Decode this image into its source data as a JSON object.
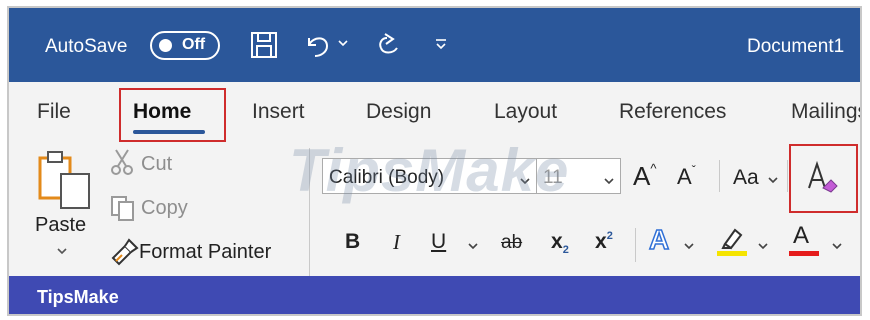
{
  "titlebar": {
    "autosave_label": "AutoSave",
    "autosave_state": "Off",
    "document_title": "Document1"
  },
  "tabs": [
    {
      "label": "File",
      "active": false
    },
    {
      "label": "Home",
      "active": true
    },
    {
      "label": "Insert",
      "active": false
    },
    {
      "label": "Design",
      "active": false
    },
    {
      "label": "Layout",
      "active": false
    },
    {
      "label": "References",
      "active": false
    },
    {
      "label": "Mailings",
      "active": false
    }
  ],
  "clipboard": {
    "paste_label": "Paste",
    "cut_label": "Cut",
    "copy_label": "Copy",
    "format_painter_label": "Format Painter"
  },
  "font": {
    "name": "Calibri (Body)",
    "size": "11",
    "grow_label": "A",
    "shrink_label": "A",
    "change_case_label": "Aa",
    "bold_label": "B",
    "italic_label": "I",
    "underline_label": "U",
    "strikethrough_label": "ab",
    "subscript_label": "x",
    "subscript_mark": "2",
    "superscript_label": "x",
    "superscript_mark": "2",
    "text_effects_label": "A",
    "font_color_label": "A"
  },
  "watermark": "TipsMake",
  "bottom_strip_label": "TipsMake",
  "colors": {
    "titlebar": "#2b579a",
    "ribbon": "#f3f3f3",
    "highlight": "#cf2c2c",
    "highlighter": "#f5e400",
    "font_color": "#e51c1c",
    "text_effects": "#2f6fd6",
    "clear_formatting_eraser": "#c35bd6",
    "bottom_strip": "#3f4ab3"
  },
  "icons": [
    "save-icon",
    "undo-icon",
    "redo-icon",
    "customize-qat-icon",
    "paste-icon",
    "cut-icon",
    "copy-icon",
    "format-painter-icon",
    "clear-formatting-icon",
    "highlighter-icon"
  ]
}
